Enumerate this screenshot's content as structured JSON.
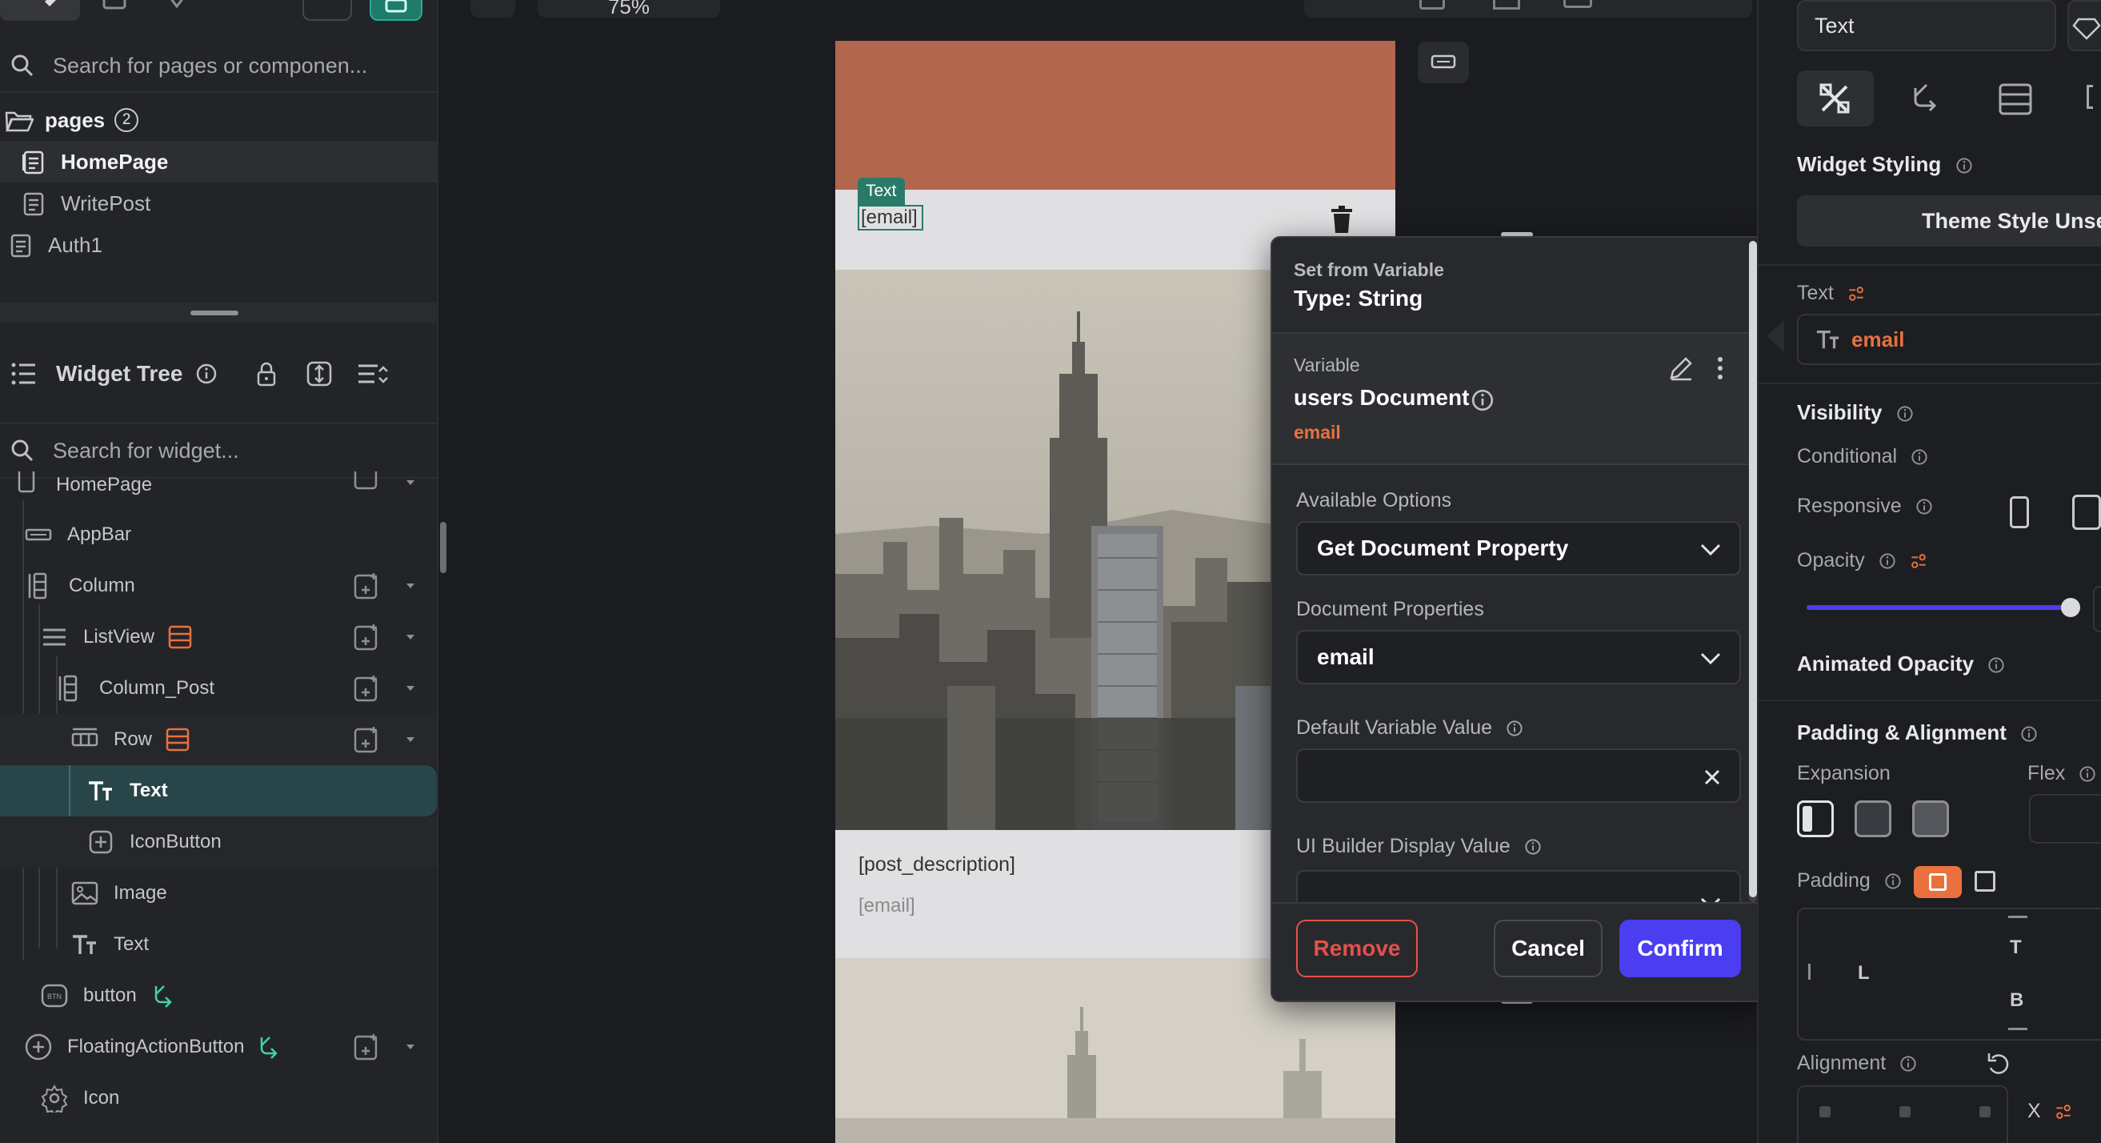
{
  "left_panel": {
    "search_pages": {
      "placeholder": "Search for pages or componen..."
    },
    "pages_folder": {
      "label": "pages",
      "count": "2"
    },
    "pages": [
      {
        "label": "HomePage",
        "selected": true
      },
      {
        "label": "WritePost"
      },
      {
        "label": "Auth1"
      }
    ],
    "widget_tree": {
      "title": "Widget Tree",
      "search_placeholder": "Search for widget...",
      "items": [
        {
          "label": "HomePage"
        },
        {
          "label": "AppBar"
        },
        {
          "label": "Column"
        },
        {
          "label": "ListView"
        },
        {
          "label": "Column_Post"
        },
        {
          "label": "Row"
        },
        {
          "label": "Text",
          "selected": true
        },
        {
          "label": "IconButton"
        },
        {
          "label": "Image"
        },
        {
          "label": "Text"
        },
        {
          "label": "button"
        },
        {
          "label": "FloatingActionButton"
        },
        {
          "label": "Icon"
        }
      ]
    }
  },
  "canvas": {
    "zoom": "75%",
    "text_chip": "Text",
    "selected_text": "[email]",
    "post_description": "[post_description]",
    "post_email": "[email]",
    "header_color": "#b2664e"
  },
  "dialog": {
    "header_caption": "Set from Variable",
    "header_type": "Type: String",
    "variable_caption": "Variable",
    "variable_name": "users Document",
    "variable_field": "email",
    "available_options_label": "Available Options",
    "available_options_value": "Get Document Property",
    "document_properties_label": "Document Properties",
    "document_properties_value": "email",
    "default_value_label": "Default Variable Value",
    "default_value": "",
    "ui_display_label": "UI Builder Display Value",
    "remove_label": "Remove",
    "cancel_label": "Cancel",
    "confirm_label": "Confirm",
    "accent": "#4b3df0",
    "remove_color": "#e5504a",
    "variable_color": "#e8713f"
  },
  "right_panel": {
    "widget_name": "Text",
    "widget_styling_title": "Widget Styling",
    "theme_style_label": "Theme Style Unse",
    "text_label": "Text",
    "text_value": "email",
    "visibility_title": "Visibility",
    "conditional_label": "Conditional",
    "responsive_label": "Responsive",
    "opacity_label": "Opacity",
    "opacity_value": 1.0,
    "animated_opacity_title": "Animated Opacity",
    "padding_alignment_title": "Padding & Alignment",
    "expansion_label": "Expansion",
    "flex_label": "Flex",
    "padding_label": "Padding",
    "padding_letters": {
      "left": "L",
      "top": "T",
      "bottom": "B"
    },
    "alignment_label": "Alignment",
    "alignment_x_label": "X"
  }
}
